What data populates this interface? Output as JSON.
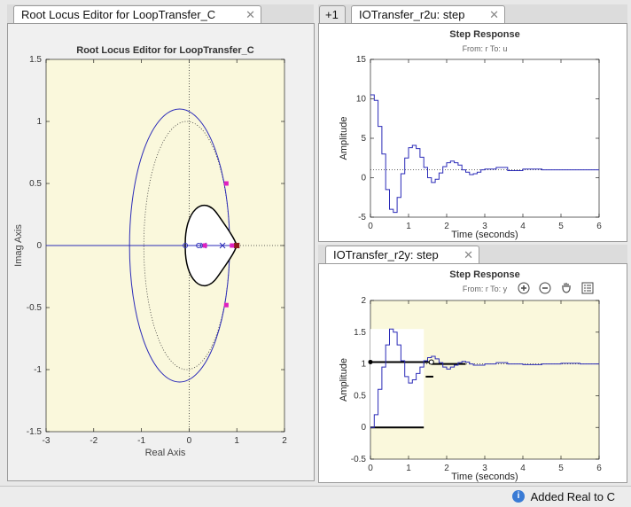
{
  "left_tab": {
    "label": "Root Locus Editor for LoopTransfer_C"
  },
  "right_top_tabs": {
    "overflow_label": "+1",
    "tab_label": "IOTransfer_r2u: step"
  },
  "right_bottom_tabs": {
    "tab_label": "IOTransfer_r2y: step"
  },
  "status": {
    "message": "Added Real to C"
  },
  "chart_data": [
    {
      "type": "scatter",
      "title": "Root Locus Editor for LoopTransfer_C",
      "xlabel": "Real Axis",
      "ylabel": "Imag Axis",
      "xlim": [
        -3,
        2
      ],
      "ylim": [
        -1.5,
        1.5
      ],
      "xticks": [
        "-3",
        "-2",
        "-1",
        "0",
        "1",
        "2"
      ],
      "yticks": [
        "1.5",
        "1",
        "0.5",
        "0",
        "-0.5",
        "-1",
        "-1.5"
      ],
      "closed_loop_poles": [
        [
          0.78,
          0.5
        ],
        [
          0.78,
          -0.48
        ],
        [
          0.33,
          0
        ],
        [
          0.9,
          0
        ],
        [
          0.95,
          0
        ]
      ],
      "open_loop_poles": [
        [
          0.3,
          0
        ],
        [
          0.7,
          0
        ],
        [
          1.0,
          0
        ]
      ],
      "zeros": [
        [
          -0.08,
          0
        ],
        [
          0.2,
          0
        ]
      ],
      "background": "#faf8dc"
    },
    {
      "type": "line",
      "title": "Step Response",
      "subtitle": "From: r  To: u",
      "xlabel": "Time (seconds)",
      "ylabel": "Amplitude",
      "xlim": [
        0,
        6
      ],
      "ylim": [
        -5,
        15
      ],
      "xticks": [
        "0",
        "1",
        "2",
        "3",
        "4",
        "5",
        "6"
      ],
      "yticks": [
        "15",
        "10",
        "5",
        "0",
        "-5"
      ],
      "steady_state": 1,
      "x": [
        0,
        0.1,
        0.2,
        0.3,
        0.4,
        0.5,
        0.6,
        0.7,
        0.8,
        0.9,
        1.0,
        1.1,
        1.2,
        1.3,
        1.4,
        1.5,
        1.6,
        1.7,
        1.8,
        1.9,
        2.0,
        2.1,
        2.2,
        2.3,
        2.4,
        2.5,
        2.6,
        2.7,
        2.8,
        2.9,
        3.0,
        3.3,
        3.6,
        4.0,
        4.5,
        5.0,
        5.5,
        6.0
      ],
      "y": [
        10.5,
        9.8,
        6.5,
        3.0,
        -1.5,
        -4.0,
        -4.4,
        -2.5,
        0.5,
        2.5,
        3.8,
        4.1,
        3.7,
        2.6,
        1.3,
        0.0,
        -0.6,
        -0.2,
        0.6,
        1.4,
        1.9,
        2.1,
        1.9,
        1.6,
        1.0,
        0.7,
        0.4,
        0.5,
        0.7,
        1.0,
        1.1,
        1.3,
        0.9,
        1.1,
        1.0,
        1.0,
        1.0,
        1.0
      ],
      "background": "#ffffff"
    },
    {
      "type": "line",
      "title": "Step Response",
      "subtitle": "From: r  To: y",
      "xlabel": "Time (seconds)",
      "ylabel": "Amplitude",
      "xlim": [
        0,
        6
      ],
      "ylim": [
        -0.5,
        2
      ],
      "xticks": [
        "0",
        "1",
        "2",
        "3",
        "4",
        "5",
        "6"
      ],
      "yticks": [
        "2",
        "1.5",
        "1",
        "0.5",
        "0",
        "-0.5"
      ],
      "steady_state": 1,
      "x": [
        0,
        0.1,
        0.2,
        0.3,
        0.4,
        0.5,
        0.6,
        0.7,
        0.8,
        0.9,
        1.0,
        1.1,
        1.2,
        1.3,
        1.4,
        1.5,
        1.6,
        1.7,
        1.8,
        1.9,
        2.0,
        2.1,
        2.2,
        2.3,
        2.4,
        2.5,
        2.6,
        2.7,
        2.8,
        3.0,
        3.3,
        3.6,
        4.0,
        4.5,
        5.0,
        5.5,
        6.0
      ],
      "y": [
        0,
        0.2,
        0.6,
        0.95,
        1.3,
        1.55,
        1.5,
        1.3,
        1.05,
        0.8,
        0.7,
        0.75,
        0.85,
        0.95,
        1.05,
        1.1,
        1.12,
        1.08,
        1.02,
        0.95,
        0.92,
        0.95,
        0.98,
        1.02,
        1.04,
        1.03,
        1.0,
        0.98,
        0.98,
        1.0,
        1.02,
        1.0,
        0.99,
        1.0,
        1.01,
        1.0,
        1.0
      ],
      "background": "#faf8dc"
    }
  ]
}
